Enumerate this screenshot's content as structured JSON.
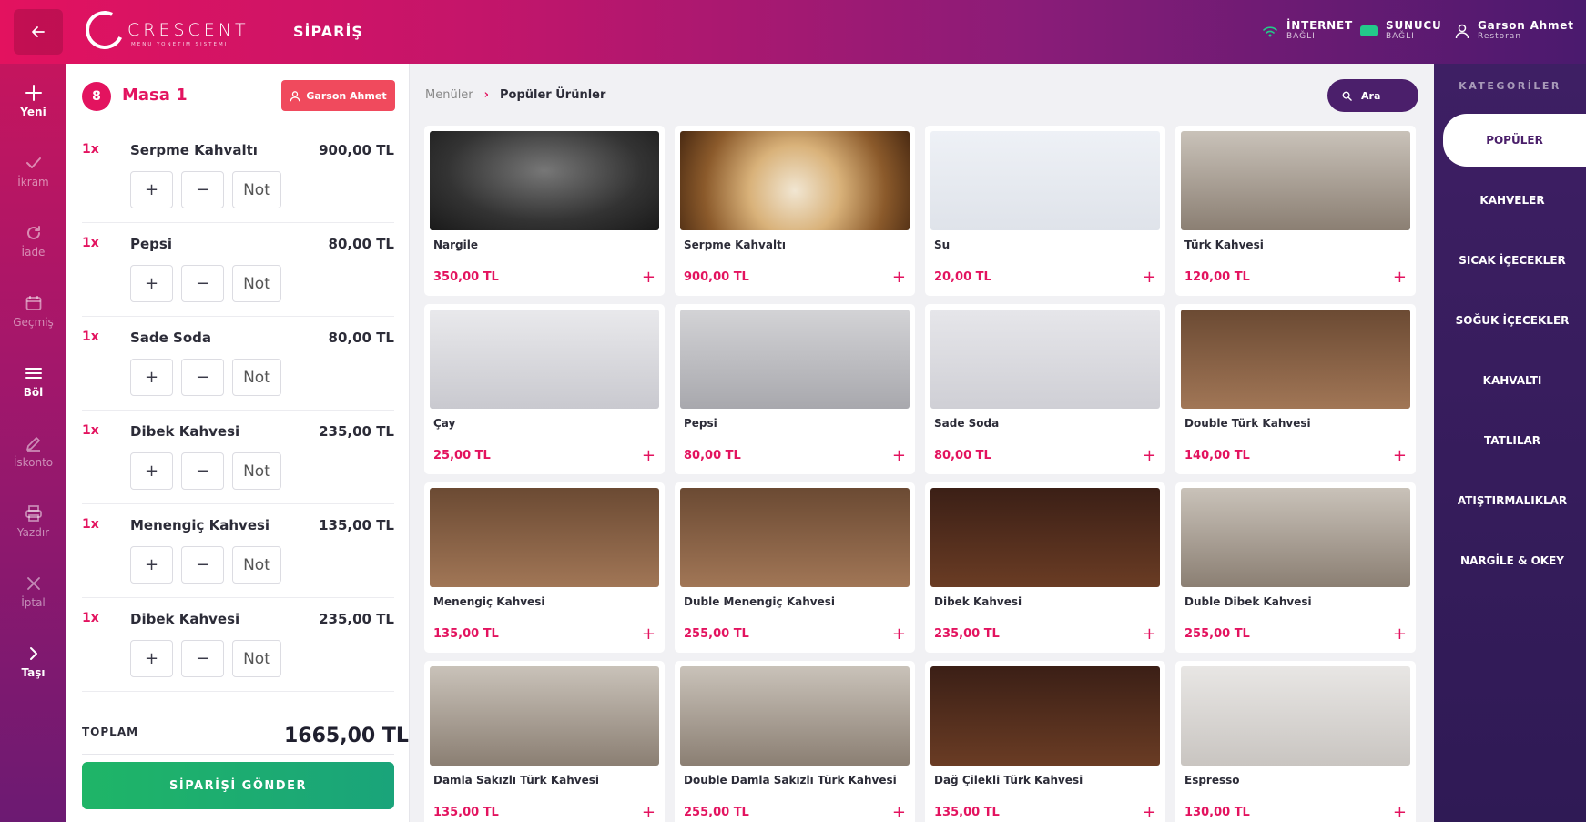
{
  "header": {
    "logo_title": "CRESCENT",
    "logo_subtitle": "MENU YONETIM SISTEMI",
    "page_title": "SİPARİŞ",
    "internet_label": "İNTERNET",
    "internet_value": "BAĞLI",
    "server_label": "SUNUCU",
    "server_value": "BAĞLI",
    "user_name": "Garson Ahmet",
    "user_role": "Restoran"
  },
  "leftnav": [
    {
      "label": "Yeni",
      "icon": "plus-icon",
      "active": true
    },
    {
      "label": "İkram",
      "icon": "check-icon",
      "active": false
    },
    {
      "label": "İade",
      "icon": "refresh-icon",
      "active": false
    },
    {
      "label": "Geçmiş",
      "icon": "calendar-icon",
      "active": false
    },
    {
      "label": "Böl",
      "icon": "menu-icon",
      "active": true
    },
    {
      "label": "İskonto",
      "icon": "pencil-icon",
      "active": false
    },
    {
      "label": "Yazdır",
      "icon": "printer-icon",
      "active": false
    },
    {
      "label": "İptal",
      "icon": "close-icon",
      "active": false
    },
    {
      "label": "Taşı",
      "icon": "chevron-right-icon",
      "active": true
    }
  ],
  "order": {
    "table_number": "8",
    "table_name": "Masa 1",
    "waiter_button": "Garson Ahmet",
    "plus_label": "+",
    "minus_label": "−",
    "note_label": "Not",
    "items": [
      {
        "qty": "1x",
        "name": "Serpme Kahvaltı",
        "price": "900,00 TL"
      },
      {
        "qty": "1x",
        "name": "Pepsi",
        "price": "80,00 TL"
      },
      {
        "qty": "1x",
        "name": "Sade Soda",
        "price": "80,00 TL"
      },
      {
        "qty": "1x",
        "name": "Dibek Kahvesi",
        "price": "235,00 TL"
      },
      {
        "qty": "1x",
        "name": "Menengiç Kahvesi",
        "price": "135,00 TL"
      },
      {
        "qty": "1x",
        "name": "Dibek Kahvesi",
        "price": "235,00 TL"
      }
    ],
    "total_label": "TOPLAM",
    "total_value": "1665,00 TL",
    "send_button": "SİPARİŞİ GÖNDER"
  },
  "breadcrumb": {
    "root": "Menüler",
    "separator": "›",
    "current": "Popüler Ürünler"
  },
  "search": {
    "label": "Ara"
  },
  "products": [
    {
      "name": "Nargile",
      "price": "350,00 TL",
      "image": "img-dark"
    },
    {
      "name": "Serpme Kahvaltı",
      "price": "900,00 TL",
      "image": "img-food"
    },
    {
      "name": "Su",
      "price": "20,00 TL",
      "image": "img-light"
    },
    {
      "name": "Türk Kahvesi",
      "price": "120,00 TL",
      "image": "img-coffee-white"
    },
    {
      "name": "Çay",
      "price": "25,00 TL",
      "image": "img-tea"
    },
    {
      "name": "Pepsi",
      "price": "80,00 TL",
      "image": "img-pepsi"
    },
    {
      "name": "Sade Soda",
      "price": "80,00 TL",
      "image": "img-soda"
    },
    {
      "name": "Double Türk Kahvesi",
      "price": "140,00 TL",
      "image": "img-coffee-wood"
    },
    {
      "name": "Menengiç Kahvesi",
      "price": "135,00 TL",
      "image": "img-coffee-wood"
    },
    {
      "name": "Duble Menengiç Kahvesi",
      "price": "255,00 TL",
      "image": "img-coffee-wood"
    },
    {
      "name": "Dibek Kahvesi",
      "price": "235,00 TL",
      "image": "img-strawberry"
    },
    {
      "name": "Duble Dibek Kahvesi",
      "price": "255,00 TL",
      "image": "img-coffee-white"
    },
    {
      "name": "Damla Sakızlı Türk Kahvesi",
      "price": "135,00 TL",
      "image": "img-coffee-white"
    },
    {
      "name": "Double Damla Sakızlı Türk Kahvesi",
      "price": "255,00 TL",
      "image": "img-coffee-white"
    },
    {
      "name": "Dağ Çilekli Türk Kahvesi",
      "price": "135,00 TL",
      "image": "img-strawberry"
    },
    {
      "name": "Espresso",
      "price": "130,00 TL",
      "image": "img-espresso"
    }
  ],
  "add_label": "+",
  "categories": {
    "title": "KATEGORİLER",
    "items": [
      {
        "label": "POPÜLER",
        "active": true
      },
      {
        "label": "KAHVELER",
        "active": false
      },
      {
        "label": "SICAK İÇECEKLER",
        "active": false
      },
      {
        "label": "SOĞUK İÇECEKLER",
        "active": false
      },
      {
        "label": "KAHVALTI",
        "active": false
      },
      {
        "label": "TATLILAR",
        "active": false
      },
      {
        "label": "ATIŞTIRMALIKLAR",
        "active": false
      },
      {
        "label": "NARGİLE & OKEY",
        "active": false
      }
    ]
  },
  "colors": {
    "accent": "#e3135f",
    "brand_purple": "#4b1f6b",
    "send_green": "#1fb567"
  }
}
